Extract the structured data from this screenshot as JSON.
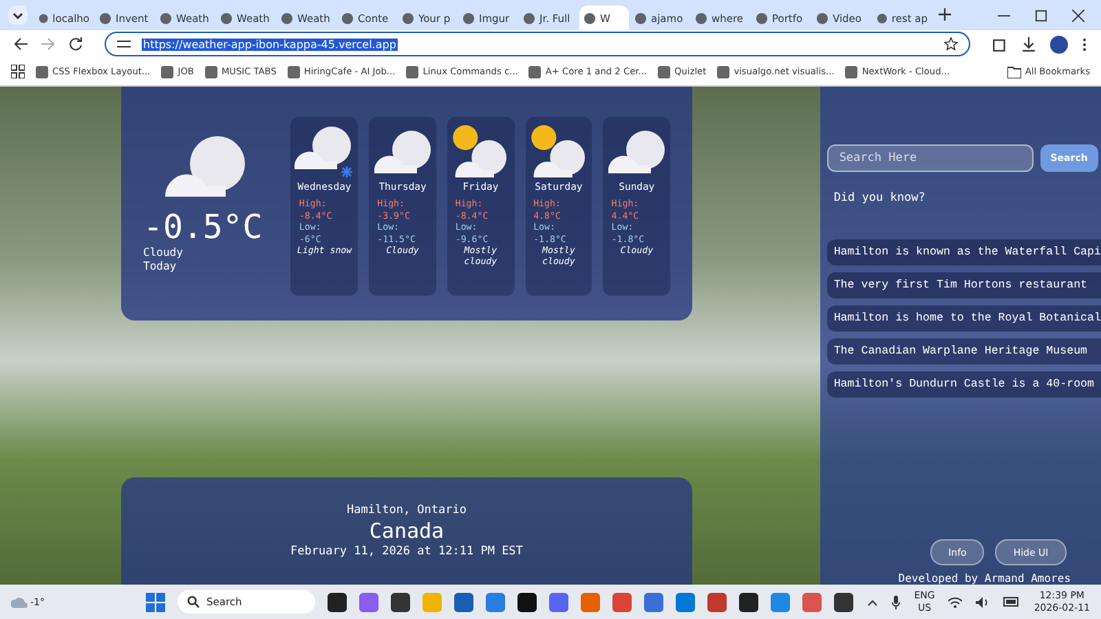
{
  "browser": {
    "tabs": [
      {
        "label": "localho",
        "selected": false
      },
      {
        "label": "Invent",
        "selected": false
      },
      {
        "label": "Weath",
        "selected": false
      },
      {
        "label": "Weath",
        "selected": false
      },
      {
        "label": "Weath",
        "selected": false
      },
      {
        "label": "Conte",
        "selected": false
      },
      {
        "label": "Your p",
        "selected": false
      },
      {
        "label": "Imgur",
        "selected": false
      },
      {
        "label": "Jr. Full",
        "selected": false
      },
      {
        "label": "W",
        "selected": true
      },
      {
        "label": "ajamo",
        "selected": false
      },
      {
        "label": "where",
        "selected": false
      },
      {
        "label": "Portfo",
        "selected": false
      },
      {
        "label": "Video",
        "selected": false
      },
      {
        "label": "rest ap",
        "selected": false
      }
    ],
    "url": "https://weather-app-ibon-kappa-45.vercel.app",
    "bookmarks": [
      "CSS Flexbox Layout...",
      "JOB",
      "MUSIC TABS",
      "HiringCafe - AI Job...",
      "Linux Commands c...",
      "A+ Core 1 and 2 Cer...",
      "Quizlet",
      "visualgo.net visualis...",
      "NextWork - Cloud..."
    ],
    "all_bookmarks": "All Bookmarks"
  },
  "current": {
    "temperature": "-0.5°C",
    "condition": "Cloudy",
    "day": "Today"
  },
  "forecast": [
    {
      "day": "Wednesday",
      "kind": "cloud-snow",
      "high_label": "High:",
      "high": "-8.4°C",
      "low_label": "Low:",
      "low": "-6°C",
      "condition": "Light snow"
    },
    {
      "day": "Thursday",
      "kind": "cloud",
      "high_label": "High:",
      "high": "-3.9°C",
      "low_label": "Low:",
      "low": "-11.5°C",
      "condition": "Cloudy"
    },
    {
      "day": "Friday",
      "kind": "sun-cloud",
      "high_label": "High:",
      "high": "-8.4°C",
      "low_label": "Low:",
      "low": "-9.6°C",
      "condition": "Mostly cloudy"
    },
    {
      "day": "Saturday",
      "kind": "sun-cloud",
      "high_label": "High:",
      "high": "4.8°C",
      "low_label": "Low:",
      "low": "-1.8°C",
      "condition": "Mostly cloudy"
    },
    {
      "day": "Sunday",
      "kind": "cloud",
      "high_label": "High:",
      "high": "4.4°C",
      "low_label": "Low:",
      "low": "-1.8°C",
      "condition": "Cloudy"
    }
  ],
  "location": {
    "city": "Hamilton, Ontario",
    "country": "Canada",
    "datetime": "February 11, 2026 at 12:11 PM EST"
  },
  "sidebar": {
    "search": {
      "placeholder": "Search Here",
      "button": "Search"
    },
    "heading": "Did you know?",
    "facts": [
      "Hamilton is known as the Waterfall Capi",
      "The very first Tim Hortons restaurant",
      "Hamilton is home to the Royal Botanical",
      "The Canadian Warplane Heritage Museum",
      "Hamilton's Dundurn Castle is a 40-room"
    ],
    "buttons": [
      "Info",
      "Hide UI"
    ],
    "credit": "Developed by Armand Amores"
  },
  "taskbar": {
    "weather": "-1°",
    "search": "Search",
    "language": "ENG",
    "region": "US",
    "time": "12:39 PM",
    "date": "2026-02-11"
  }
}
